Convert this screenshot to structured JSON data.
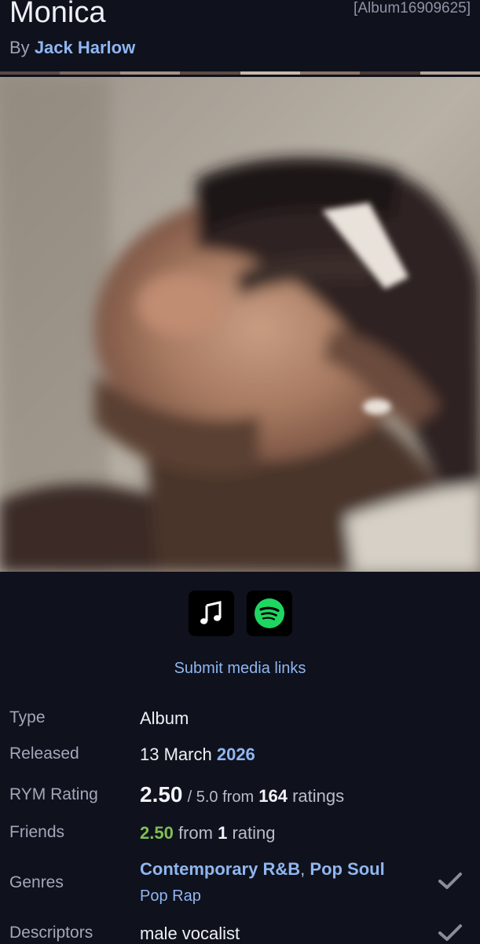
{
  "header": {
    "title": "Monica",
    "album_id": "[Album16909625]",
    "by_prefix": "By",
    "artist": "Jack Harlow"
  },
  "divider_colors": [
    "#5a4a44",
    "#7a6a5e",
    "#a49383",
    "#5e4c44",
    "#c8b9a9",
    "#8b7566",
    "#4a3b36",
    "#b2a496"
  ],
  "media": {
    "apple_music_icon": "music-note-icon",
    "spotify_icon": "spotify-icon",
    "spotify_color": "#1ed760",
    "submit_link": "Submit media links"
  },
  "info": {
    "type": {
      "label": "Type",
      "value": "Album"
    },
    "released": {
      "label": "Released",
      "day_month": "13 March",
      "year": "2026"
    },
    "rym_rating": {
      "label": "RYM Rating",
      "score": "2.50",
      "out_of": "/ 5.0 from",
      "count": "164",
      "suffix": "ratings"
    },
    "friends": {
      "label": "Friends",
      "score": "2.50",
      "from": "from",
      "count": "1",
      "suffix": "rating"
    },
    "genres": {
      "label": "Genres",
      "primary": [
        "Contemporary R&B",
        "Pop Soul"
      ],
      "separator": ",",
      "secondary": [
        "Pop Rap"
      ]
    },
    "descriptors": {
      "label": "Descriptors",
      "value": "male vocalist"
    }
  }
}
